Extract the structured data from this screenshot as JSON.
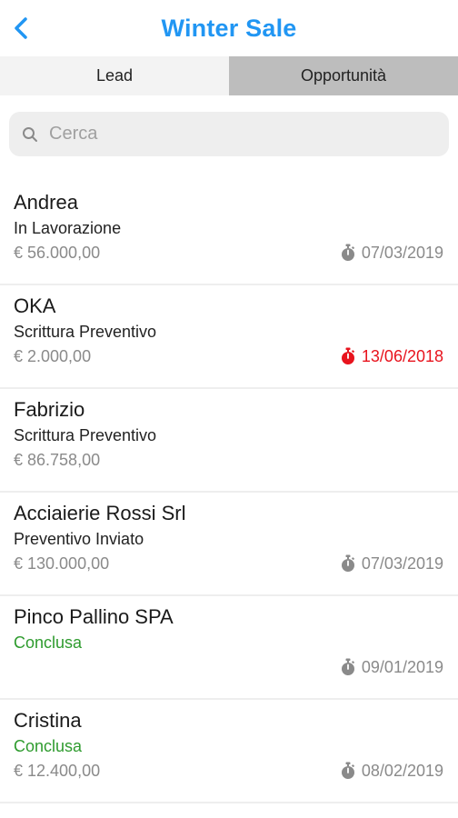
{
  "header": {
    "title": "Winter Sale",
    "back_icon": "chevron-left-icon",
    "accent_color": "#2196f3"
  },
  "tabs": [
    {
      "label": "Lead",
      "active": true
    },
    {
      "label": "Opportunità",
      "active": false
    }
  ],
  "search": {
    "placeholder": "Cerca",
    "value": "",
    "icon": "search-icon"
  },
  "items": [
    {
      "name": "Andrea",
      "status": "In Lavorazione",
      "amount": "€ 56.000,00",
      "date": "07/03/2019",
      "overdue": false,
      "done": false
    },
    {
      "name": "OKA",
      "status": "Scrittura Preventivo",
      "amount": "€ 2.000,00",
      "date": "13/06/2018",
      "overdue": true,
      "done": false
    },
    {
      "name": "Fabrizio",
      "status": "Scrittura Preventivo",
      "amount": "€ 86.758,00",
      "date": "",
      "overdue": false,
      "done": false
    },
    {
      "name": "Acciaierie Rossi Srl",
      "status": "Preventivo Inviato",
      "amount": "€ 130.000,00",
      "date": "07/03/2019",
      "overdue": false,
      "done": false
    },
    {
      "name": "Pinco Pallino SPA",
      "status": "Conclusa",
      "amount": "",
      "date": "09/01/2019",
      "overdue": false,
      "done": true
    },
    {
      "name": "Cristina",
      "status": "Conclusa",
      "amount": "€ 12.400,00",
      "date": "08/02/2019",
      "overdue": false,
      "done": true
    }
  ],
  "colors": {
    "overdue": "#e8131d",
    "done": "#2e9b2e",
    "muted": "#8a8a8a"
  }
}
